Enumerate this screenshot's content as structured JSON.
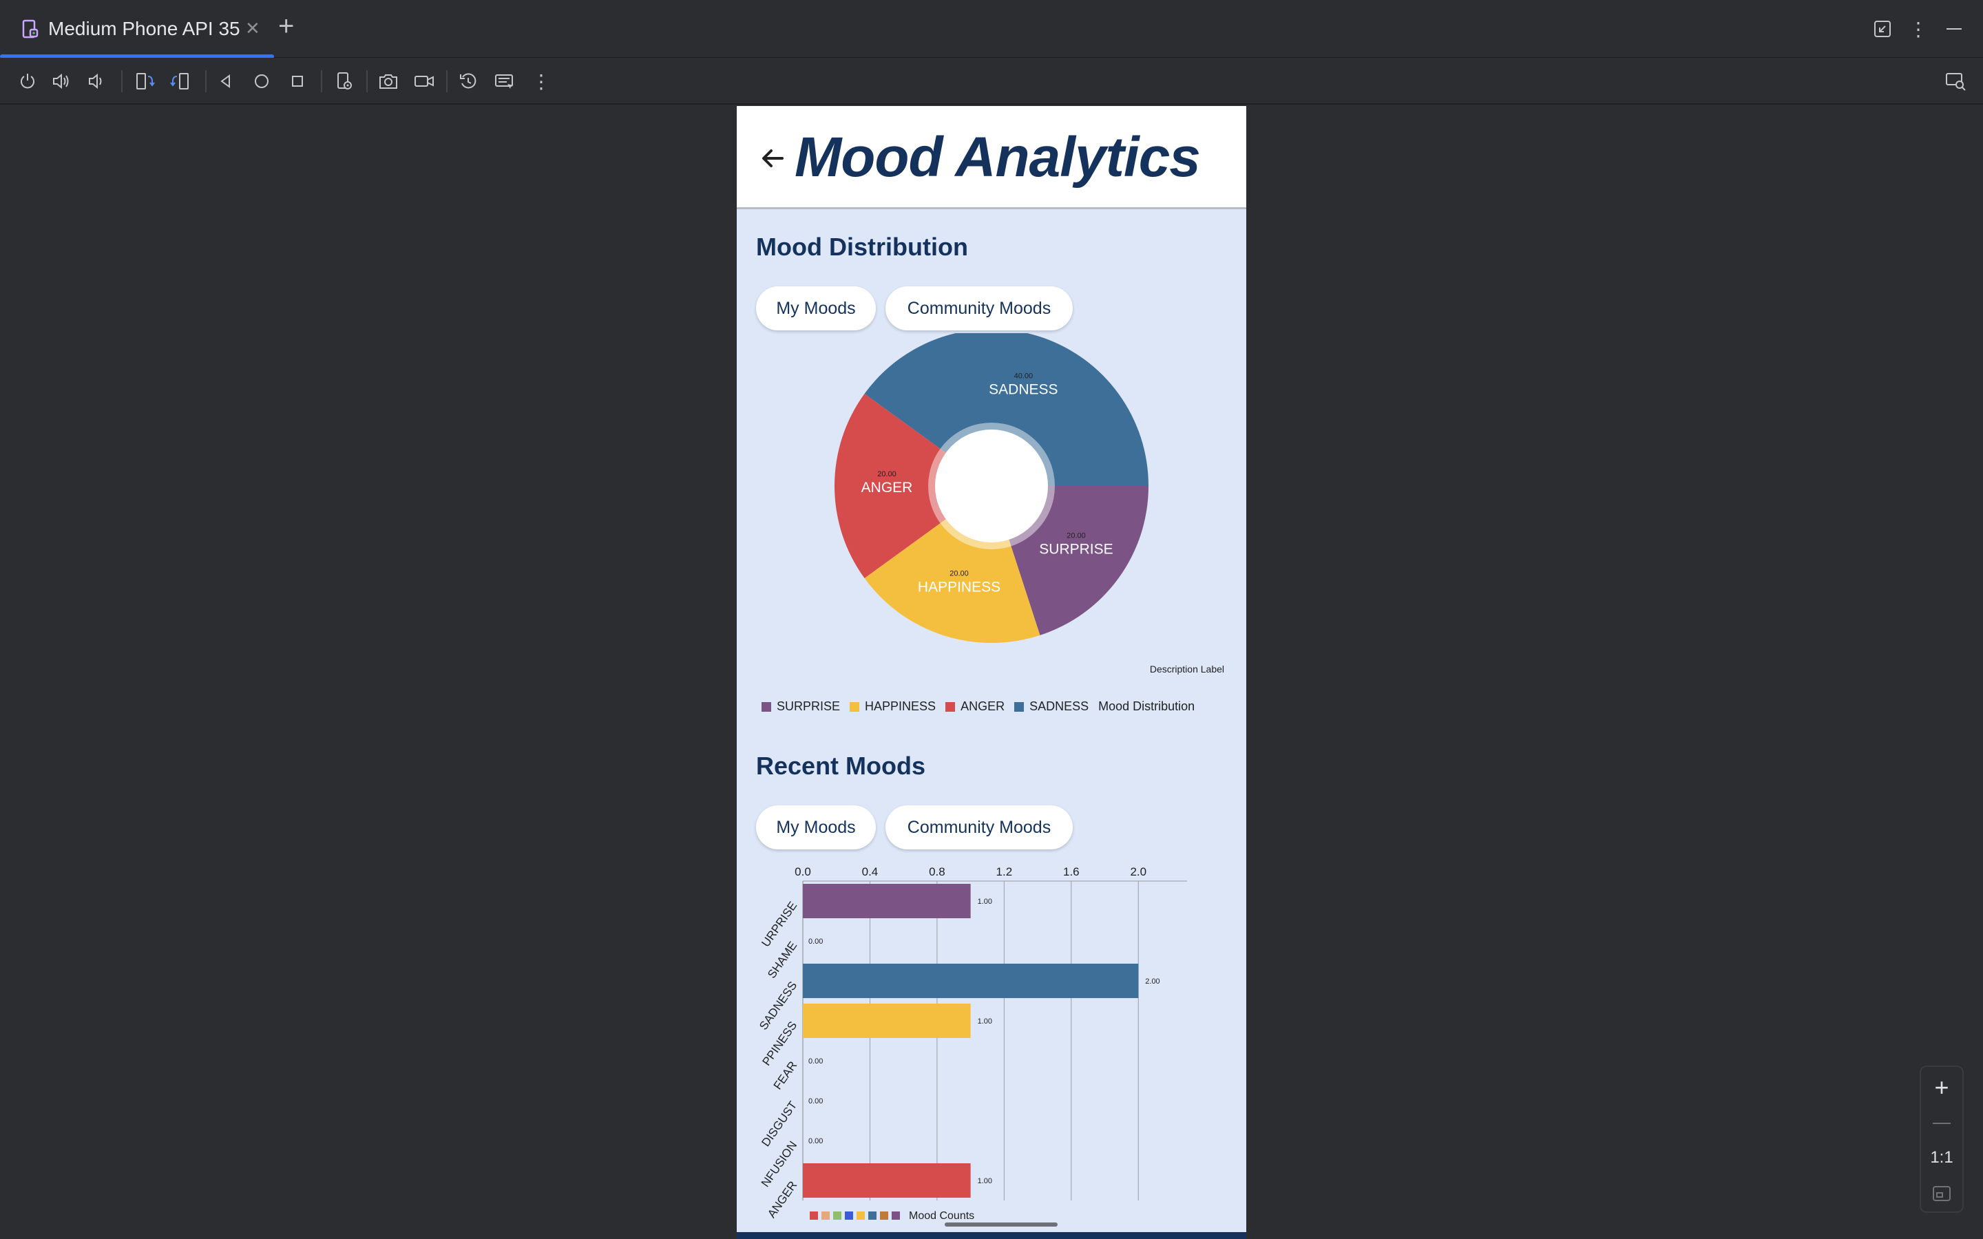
{
  "window": {
    "tab_title": "Medium Phone API 35"
  },
  "app": {
    "title": "Mood Analytics",
    "section_distribution": "Mood Distribution",
    "section_recent": "Recent Moods",
    "toggle_my": "My Moods",
    "toggle_community": "Community Moods",
    "description_label": "Description Label"
  },
  "pie_legend": [
    {
      "label": "SURPRISE",
      "color": "#7b5384"
    },
    {
      "label": "HAPPINESS",
      "color": "#f4bf3f"
    },
    {
      "label": "ANGER",
      "color": "#d64b4b"
    },
    {
      "label": "SADNESS",
      "color": "#3d6f99"
    },
    {
      "label": "Mood Distribution",
      "color": null
    }
  ],
  "bar_legend_label": "Mood Counts",
  "bar_legend_colors": [
    "#d64b4b",
    "#e8a87c",
    "#8fbf6a",
    "#3d5bd9",
    "#f4bf3f",
    "#3d6f99",
    "#c07a3a",
    "#7b5384"
  ],
  "chart_data": [
    {
      "type": "pie",
      "title": "",
      "categories": [
        "SADNESS",
        "SURPRISE",
        "HAPPINESS",
        "ANGER"
      ],
      "values": [
        40.0,
        20.0,
        20.0,
        20.0
      ],
      "value_labels": [
        "40.00",
        "20.00",
        "20.00",
        "20.00"
      ],
      "colors": [
        "#3d6f99",
        "#7b5384",
        "#f4bf3f",
        "#d64b4b"
      ],
      "legend": "bottom-left",
      "hole": true
    },
    {
      "type": "bar",
      "orientation": "horizontal",
      "title": "",
      "categories": [
        "SURPRISE",
        "SHAME",
        "SADNESS",
        "HAPPINESS",
        "FEAR",
        "DISGUST",
        "CONFUSION",
        "ANGER"
      ],
      "category_tick_labels": [
        "URPRISE",
        "SHAME",
        "SADNESS",
        "PPINESS",
        "FEAR",
        "DISGUST",
        "NFUSION",
        "ANGER"
      ],
      "series": [
        {
          "name": "Mood Counts",
          "values": [
            1,
            0,
            2,
            1,
            0,
            0,
            0,
            1
          ]
        }
      ],
      "value_labels": [
        "1.00",
        "0.00",
        "2.00",
        "1.00",
        "0.00",
        "0.00",
        "0.00",
        "1.00"
      ],
      "colors": [
        "#7b5384",
        "#e8a87c",
        "#3d6f99",
        "#f4bf3f",
        "#3d5bd9",
        "#8fbf6a",
        "#c07a3a",
        "#d64b4b"
      ],
      "xlim": [
        0,
        2.2
      ],
      "x_ticks": [
        "0.0",
        "0.4",
        "0.8",
        "1.2",
        "1.6",
        "2.0"
      ],
      "grid": true,
      "legend": "bottom"
    }
  ]
}
